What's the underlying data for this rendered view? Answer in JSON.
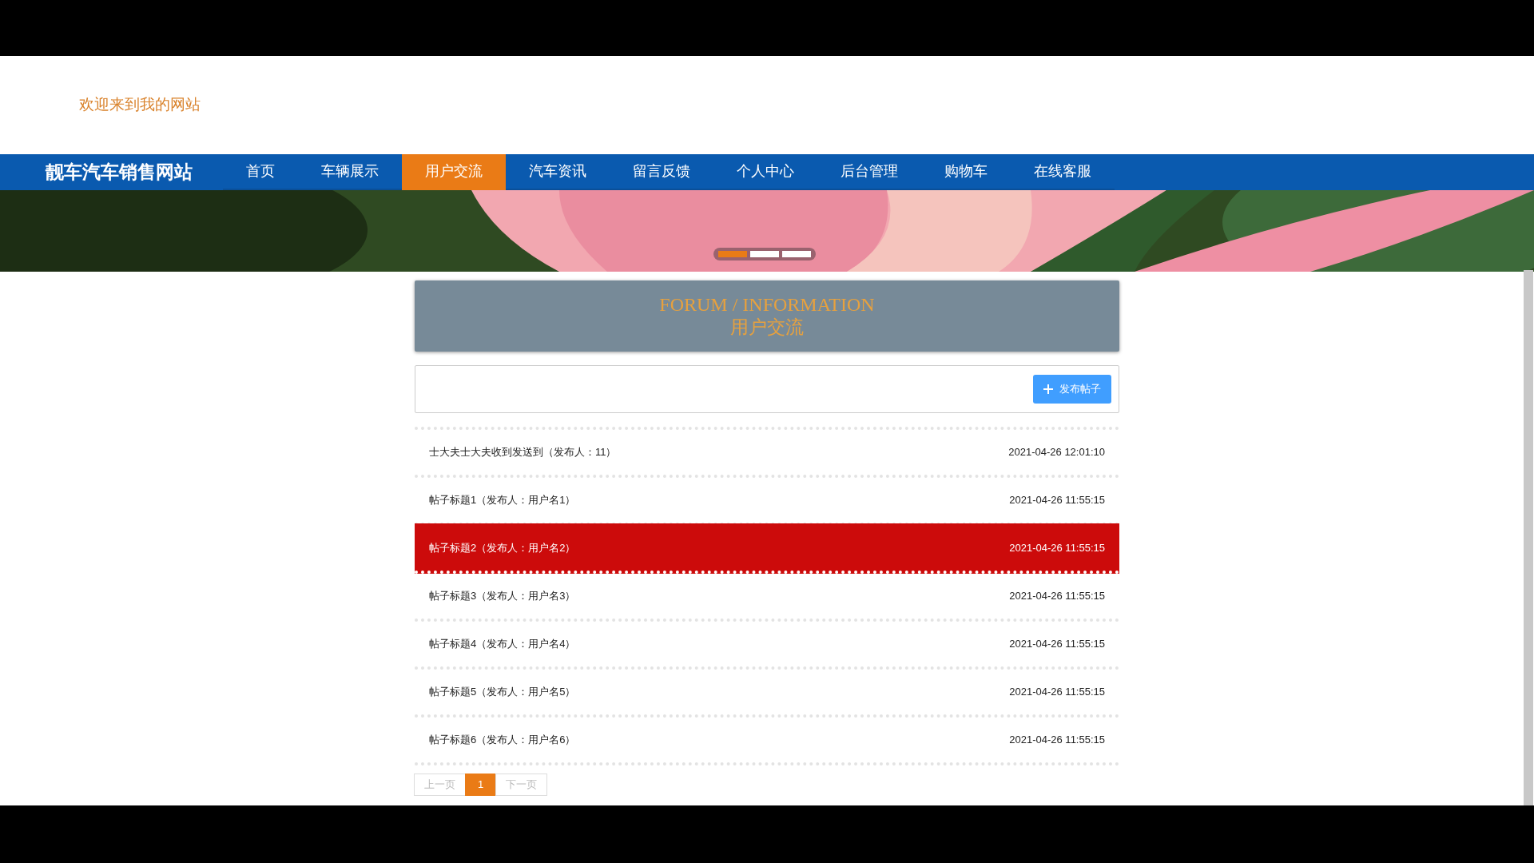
{
  "header": {
    "welcome": "欢迎来到我的网站"
  },
  "navbar": {
    "brand": "靓车汽车销售网站",
    "items": [
      {
        "label": "首页",
        "selected": false
      },
      {
        "label": "车辆展示",
        "selected": false
      },
      {
        "label": "用户交流",
        "selected": true
      },
      {
        "label": "汽车资讯",
        "selected": false
      },
      {
        "label": "留言反馈",
        "selected": false
      },
      {
        "label": "个人中心",
        "selected": false
      },
      {
        "label": "后台管理",
        "selected": false
      },
      {
        "label": "购物车",
        "selected": false
      },
      {
        "label": "在线客服",
        "selected": false
      }
    ]
  },
  "banner": {
    "indicators": [
      {
        "selected": true
      },
      {
        "selected": false
      },
      {
        "selected": false
      }
    ]
  },
  "section_header": {
    "title_en": "FORUM / INFORMATION",
    "title_cn": "用户交流"
  },
  "toolbar": {
    "button": "发布帖子"
  },
  "posts": [
    {
      "title": "士大夫士大夫收到发送到（发布人：11）",
      "time": "2021-04-26 12:01:10",
      "highlighted": false
    },
    {
      "title": "帖子标题1（发布人：用户名1）",
      "time": "2021-04-26 11:55:15",
      "highlighted": false
    },
    {
      "title": "帖子标题2（发布人：用户名2）",
      "time": "2021-04-26 11:55:15",
      "highlighted": true
    },
    {
      "title": "帖子标题3（发布人：用户名3）",
      "time": "2021-04-26 11:55:15",
      "highlighted": false
    },
    {
      "title": "帖子标题4（发布人：用户名4）",
      "time": "2021-04-26 11:55:15",
      "highlighted": false
    },
    {
      "title": "帖子标题5（发布人：用户名5）",
      "time": "2021-04-26 11:55:15",
      "highlighted": false
    },
    {
      "title": "帖子标题6（发布人：用户名6）",
      "time": "2021-04-26 11:55:15",
      "highlighted": false
    }
  ],
  "pagination": [
    {
      "label": "上一页",
      "selected": false,
      "disabled": true
    },
    {
      "label": "1",
      "selected": true,
      "disabled": false
    },
    {
      "label": "下一页",
      "selected": false,
      "disabled": true
    }
  ]
}
